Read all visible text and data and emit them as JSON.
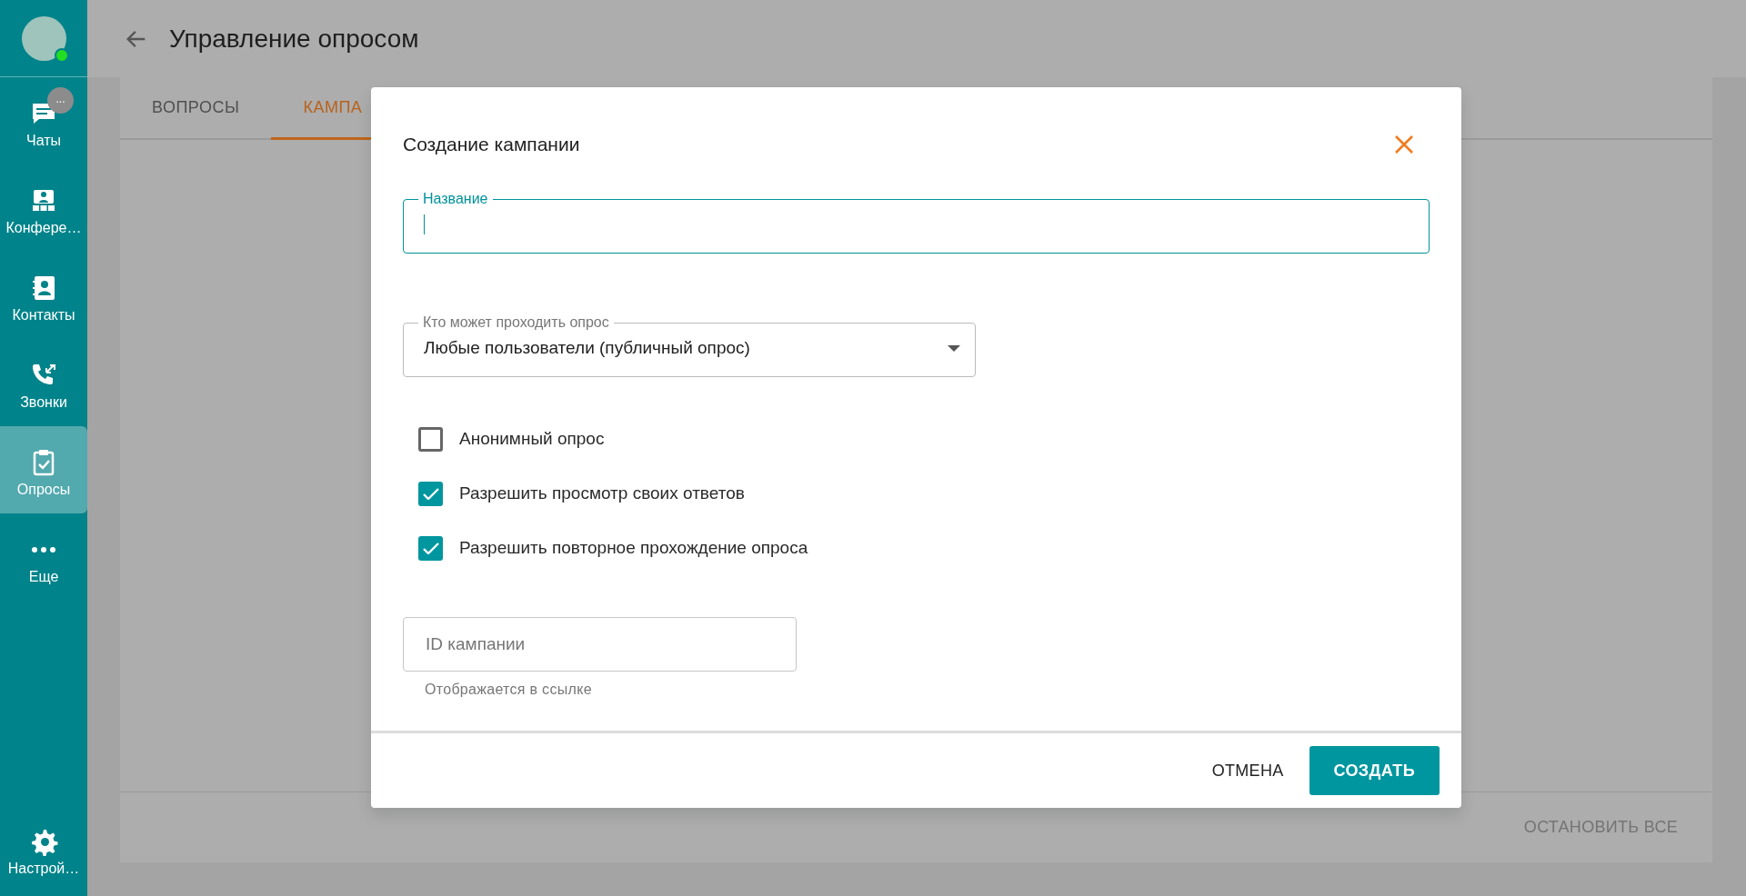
{
  "sidebar": {
    "avatar": {
      "online": true
    },
    "items": [
      {
        "label": "Чаты",
        "badge": "...",
        "selected": false
      },
      {
        "label": "Конфере…",
        "selected": false
      },
      {
        "label": "Контакты",
        "selected": false
      },
      {
        "label": "Звонки",
        "selected": false
      },
      {
        "label": "Опросы",
        "selected": true
      },
      {
        "label": "Еще",
        "selected": false
      }
    ],
    "bottom_item": {
      "label": "Настрой…"
    }
  },
  "header": {
    "title": "Управление опросом"
  },
  "tabs": [
    {
      "label": "ВОПРОСЫ",
      "selected": false
    },
    {
      "label": "КАМПА",
      "selected": true
    }
  ],
  "footer_action": "ОСТАНОВИТЬ ВСЕ",
  "dialog": {
    "title": "Создание кампании",
    "name_field": {
      "label": "Название",
      "focused": true
    },
    "audience_select": {
      "label": "Кто может проходить опрос",
      "value": "Любые пользователи (публичный опрос)"
    },
    "options": [
      {
        "label": "Анонимный опрос",
        "checked": false
      },
      {
        "label": "Разрешить просмотр своих ответов",
        "checked": true
      },
      {
        "label": "Разрешить повторное прохождение опроса",
        "checked": true
      }
    ],
    "id_field": {
      "placeholder": "ID кампании",
      "helper": "Отображается в ссылке"
    },
    "buttons": [
      {
        "label": "ОТМЕНА",
        "kind": "text"
      },
      {
        "label": "СОЗДАТЬ",
        "kind": "primary"
      }
    ]
  }
}
